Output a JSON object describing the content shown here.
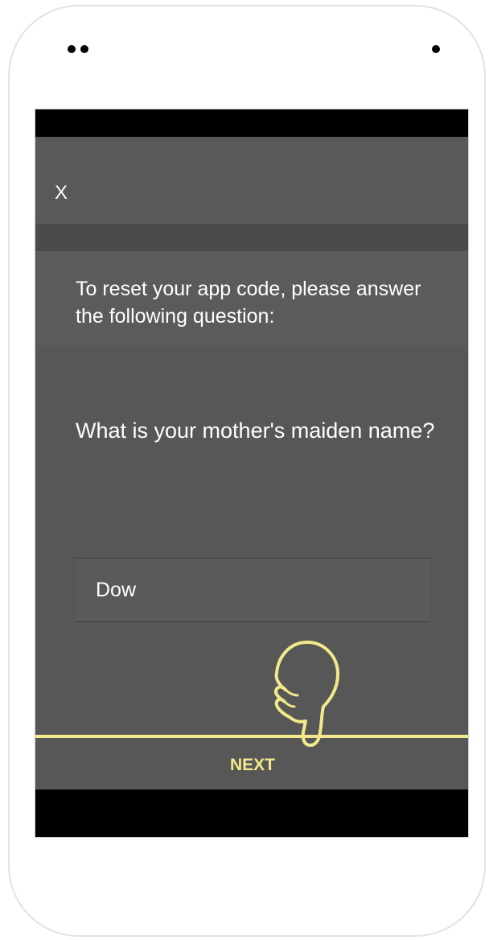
{
  "header": {
    "close_label": "X"
  },
  "instruction": {
    "text": "To reset your app code, please answer the following question:"
  },
  "question": {
    "text": "What is your mother's maiden name?"
  },
  "answer": {
    "value": "Dow"
  },
  "actions": {
    "next_label": "NEXT"
  },
  "icons": {
    "pointer": "hand-pointer-icon"
  },
  "colors": {
    "accent": "#f2e98a",
    "screen_bg": "#575757",
    "bars": "#000000"
  }
}
